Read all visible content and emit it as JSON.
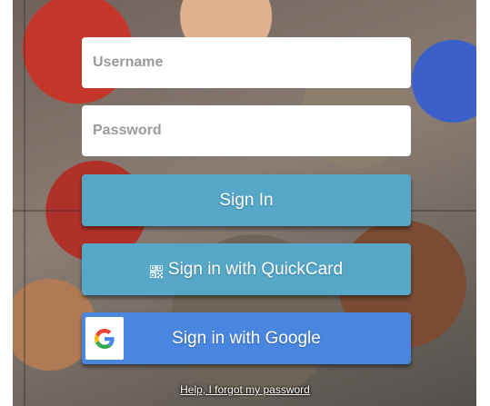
{
  "login": {
    "username_placeholder": "Username",
    "password_placeholder": "Password",
    "signin_label": "Sign In",
    "quickcard_label": "Sign in with QuickCard",
    "google_label": "Sign in with Google",
    "help_link": "Help, I forgot my password"
  },
  "icons": {
    "quickcard": "qr-code-icon",
    "google": "google-g-icon"
  },
  "colors": {
    "primary_button": "#56a7c8",
    "google_button": "#4a86e0",
    "input_background": "#ffffff"
  }
}
